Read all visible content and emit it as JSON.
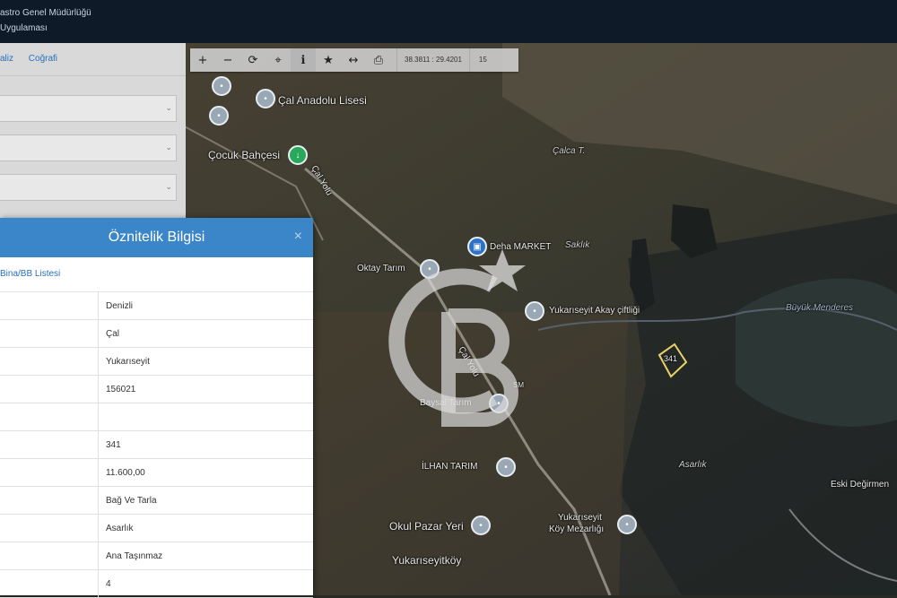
{
  "header": {
    "line1": "astro Genel Müdürlüğü",
    "line2": "Uygulaması"
  },
  "left_panel": {
    "tabs": [
      "aliz",
      "Coğrafi"
    ]
  },
  "toolbar": {
    "tools": [
      {
        "icon": "zoom-in-icon",
        "glyph": "+"
      },
      {
        "icon": "zoom-out-icon",
        "glyph": "−"
      },
      {
        "icon": "refresh-icon",
        "glyph": "⟳"
      },
      {
        "icon": "locate-icon",
        "glyph": "⌖"
      },
      {
        "icon": "info-icon",
        "glyph": "ℹ"
      },
      {
        "icon": "star-icon",
        "glyph": "★"
      },
      {
        "icon": "measure-icon",
        "glyph": "↔"
      },
      {
        "icon": "print-icon",
        "glyph": "⎙"
      }
    ],
    "coordinates": "38.3811 : 29.4201",
    "zoom_level": "15"
  },
  "attribute_panel": {
    "title": "Öznitelik Bilgisi",
    "close": "×",
    "link": "Bina/BB Listesi",
    "rows": [
      "Denizli",
      "Çal",
      "Yukarıseyit",
      "156021",
      "",
      "341",
      "11.600,00",
      "Bağ Ve Tarla",
      "Asarlık",
      "Ana Taşınmaz",
      "4"
    ]
  },
  "map": {
    "labels": {
      "cal_anadolu": "Çal Anadolu Lisesi",
      "cocuk_bahcesi": "Çocuk Bahçesi",
      "cal_yolu_1": "Çal Yolu",
      "cal_yolu_2": "Çal Yolu",
      "calca": "Çalca T.",
      "market": "Deha MARKET",
      "oktay": "Oktay Tarım",
      "akay": "Yukarıseyit Akay çiftliği",
      "menderes": "Büyük Menderes",
      "parcel": "341",
      "baysal": "Baysal Tarım",
      "ilhan": "İLHAN TARIM",
      "asarlik": "Asarlık",
      "eski": "Eski Değirmen",
      "okul": "Okul Pazar Yeri",
      "mezar1": "Yukarıseyit",
      "mezar2": "Köy Mezarlığı",
      "koy": "Yukarıseyitköy",
      "sm": "SM",
      "sakli": "Saklık"
    }
  }
}
